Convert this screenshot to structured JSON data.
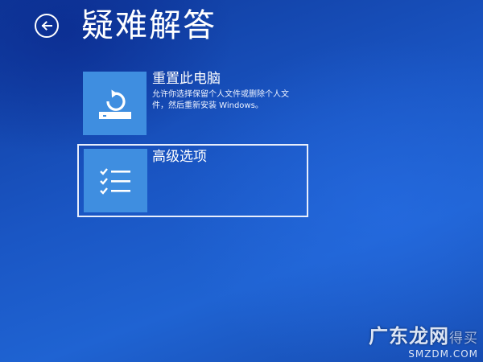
{
  "screen": {
    "title": "疑难解答",
    "back_icon": "back-arrow-icon"
  },
  "options": [
    {
      "title": "重置此电脑",
      "description": "允许你选择保留个人文件或删除个人文件，然后重新安装 Windows。",
      "icon": "reset-pc-icon"
    },
    {
      "title": "高级选项",
      "description": "",
      "icon": "checklist-icon",
      "selected": true
    }
  ],
  "watermark": {
    "brand": "广东龙网",
    "brand_suffix": "得买",
    "site": "SMZDM.COM"
  },
  "colors": {
    "background": "#1a56c4",
    "tile_icon_bg": "#3f8ee0",
    "text": "#ffffff"
  }
}
